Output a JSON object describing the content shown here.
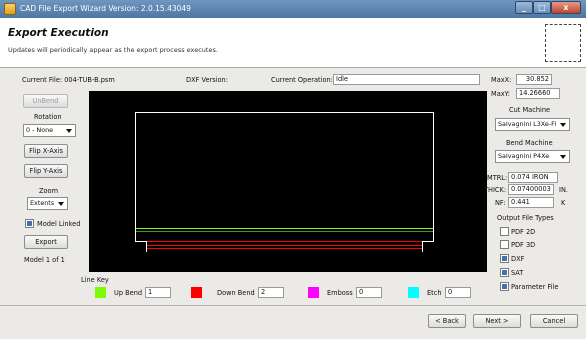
{
  "window": {
    "title": "CAD File Export Wizard Version: 2.0.15.43049"
  },
  "header": {
    "title": "Export Execution",
    "subtitle": "Updates will periodically appear as the export process executes."
  },
  "status": {
    "current_file_label": "Current File: 004-TUB-B.psm",
    "dxf_version_label": "DXF Version:",
    "current_operation_label": "Current Operation:",
    "current_operation_value": "Idle",
    "max_x_label": "MaxX:",
    "max_x_value": "30.852",
    "max_y_label": "MaxY:",
    "max_y_value": "14.26660"
  },
  "left_panel": {
    "unbend_label": "UnBend",
    "rotation_label": "Rotation",
    "rotation_value": "0 - None",
    "flip_x_label": "Flip X-Axis",
    "flip_y_label": "Flip Y-Axis",
    "zoom_label": "Zoom",
    "zoom_value": "Extents",
    "model_linked_label": "Model Linked",
    "model_linked_checked": true,
    "export_label": "Export",
    "model_count": "Model 1 of 1"
  },
  "right_panel": {
    "cut_machine_label": "Cut Machine",
    "cut_machine_value": "Salvagnini L3Xe-Fi",
    "bend_machine_label": "Bend Machine",
    "bend_machine_value": "Salvagnini P4Xe",
    "mtrl_label": "MTRL:",
    "mtrl_value": "0.074 IRON",
    "thick_label": "THICK:",
    "thick_value": "0.07400003",
    "thick_unit": "IN.",
    "nf_label": "NF:",
    "nf_value": "0.441",
    "nf_unit": "K",
    "output_types_label": "Output File Types",
    "output_types": [
      {
        "label": "PDF 2D",
        "checked": false
      },
      {
        "label": "PDF 3D",
        "checked": false
      },
      {
        "label": "DXF",
        "checked": true
      },
      {
        "label": "SAT",
        "checked": true
      },
      {
        "label": "Parameter File",
        "checked": true
      }
    ]
  },
  "line_key": {
    "title": "Line Key",
    "items": [
      {
        "label": "Up Bend",
        "value": "1",
        "color": "#7cfc00"
      },
      {
        "label": "Down Bend",
        "value": "2",
        "color": "#ff0000"
      },
      {
        "label": "Emboss",
        "value": "0",
        "color": "#ff00ff"
      },
      {
        "label": "Etch",
        "value": "0",
        "color": "#00ffff"
      }
    ]
  },
  "nav": {
    "back_label": "< Back",
    "next_label": "Next >",
    "cancel_label": "Cancel"
  },
  "colors": {
    "part_outline": "#ffffff",
    "up_bend_line": "#7cfc00",
    "down_bend_line": "#ff0000",
    "preview_bg": "#000000"
  }
}
